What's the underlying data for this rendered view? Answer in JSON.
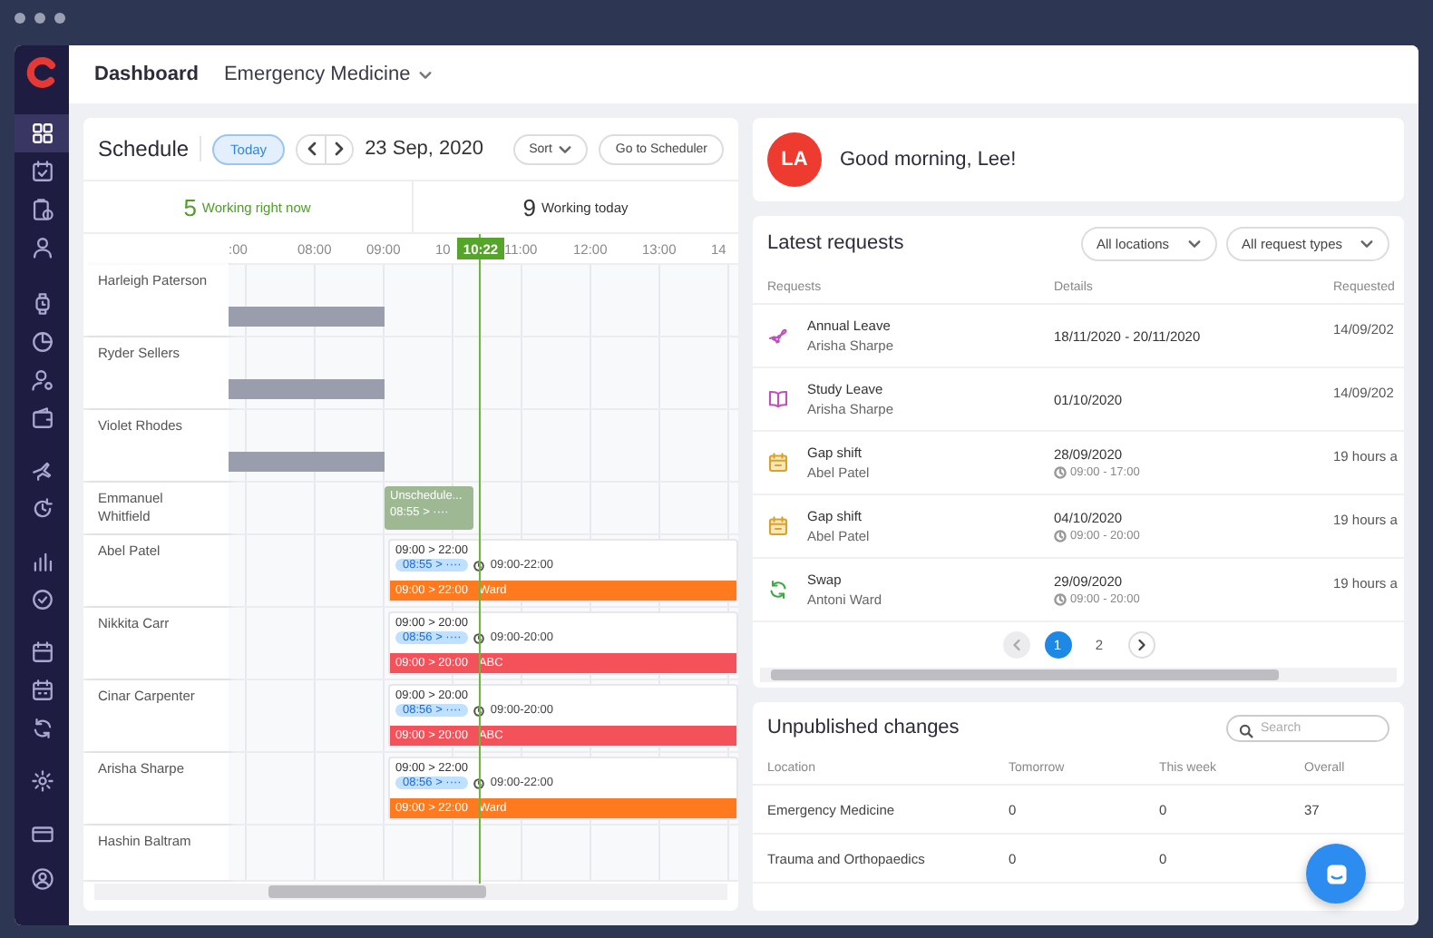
{
  "sidebar": {
    "items": [
      {
        "selected": true
      },
      {
        "selected": false
      },
      {
        "selected": false
      },
      {
        "selected": false
      },
      {
        "selected": false
      },
      {
        "selected": false
      },
      {
        "selected": false
      },
      {
        "selected": false
      },
      {
        "selected": false
      },
      {
        "selected": false
      },
      {
        "selected": false
      },
      {
        "selected": false
      },
      {
        "selected": false
      },
      {
        "selected": false
      },
      {
        "selected": false
      },
      {
        "selected": false
      },
      {
        "selected": false
      },
      {
        "selected": false
      }
    ]
  },
  "header": {
    "title": "Dashboard",
    "location": "Emergency Medicine"
  },
  "schedule": {
    "title": "Schedule",
    "today": "Today",
    "date": "23 Sep, 2020",
    "sort": "Sort",
    "goto": "Go to Scheduler",
    "stats": [
      {
        "kind": "now",
        "count": "5",
        "label": "Working right now"
      },
      {
        "kind": "total",
        "count": "9",
        "label": "Working today"
      }
    ],
    "hours": [
      ":00",
      "08:00",
      "09:00",
      "10",
      "11:00",
      "12:00",
      "13:00",
      "14"
    ],
    "now": "10:22",
    "rows": [
      {
        "kind": "off",
        "name": "Harleigh Paterson"
      },
      {
        "kind": "off",
        "name": "Ryder Sellers"
      },
      {
        "kind": "off",
        "name": "Violet Rhodes"
      },
      {
        "kind": "unscheduled",
        "name": "Emmanuel Whitfield",
        "label": "Unschedule...",
        "clock": "08:55 >  ····"
      },
      {
        "kind": "shift",
        "name": "Abel Patel",
        "planned": "09:00 > 22:00",
        "clock": "08:55 >  ····",
        "window": "09:00-22:00",
        "band": "09:00 > 22:00",
        "area": "Ward",
        "color": "#ff7a1f"
      },
      {
        "kind": "shift",
        "name": "Nikkita Carr",
        "planned": "09:00 > 20:00",
        "clock": "08:56 >  ····",
        "window": "09:00-20:00",
        "band": "09:00 > 20:00",
        "area": "ABC",
        "color": "#f4525a"
      },
      {
        "kind": "shift",
        "name": "Cinar Carpenter",
        "planned": "09:00 > 20:00",
        "clock": "08:56 >  ····",
        "window": "09:00-20:00",
        "band": "09:00 > 20:00",
        "area": "ABC",
        "color": "#f4525a"
      },
      {
        "kind": "shift",
        "name": "Arisha Sharpe",
        "planned": "09:00 > 22:00",
        "clock": "08:56 >  ····",
        "window": "09:00-22:00",
        "band": "09:00 > 22:00",
        "area": "Ward",
        "color": "#ff7a1f"
      },
      {
        "kind": "empty",
        "name": "Hashin Baltram"
      }
    ]
  },
  "greeting": {
    "initials": "LA",
    "text": "Good morning, Lee!"
  },
  "requests": {
    "title": "Latest requests",
    "filters": [
      "All locations",
      "All request types"
    ],
    "columns": [
      "Requests",
      "Details",
      "Requested"
    ],
    "rows": [
      {
        "kind": "annual",
        "type": "Annual Leave",
        "name": "Arisha Sharpe",
        "details": "18/11/2020 - 20/11/2020",
        "requested": "14/09/202"
      },
      {
        "kind": "study",
        "type": "Study Leave",
        "name": "Arisha Sharpe",
        "details": "01/10/2020",
        "requested": "14/09/202"
      },
      {
        "kind": "gap",
        "type": "Gap shift",
        "name": "Abel Patel",
        "details": "28/09/2020",
        "time": "09:00 - 17:00",
        "requested": "19 hours a"
      },
      {
        "kind": "gap",
        "type": "Gap shift",
        "name": "Abel Patel",
        "details": "04/10/2020",
        "time": "09:00 - 20:00",
        "requested": "19 hours a"
      },
      {
        "kind": "swap",
        "type": "Swap",
        "name": "Antoni Ward",
        "details": "29/09/2020",
        "time": "09:00 - 20:00",
        "requested": "19 hours a"
      }
    ],
    "prev": {
      "disabled": true
    },
    "pages": [
      {
        "label": "1",
        "selected": true
      },
      {
        "label": "2",
        "selected": false
      }
    ],
    "next": {
      "disabled": false
    }
  },
  "unpublished": {
    "title": "Unpublished changes",
    "search": {
      "placeholder": "Search"
    },
    "columns": [
      "Location",
      "Tomorrow",
      "This week",
      "Overall"
    ],
    "rows": [
      [
        "Emergency Medicine",
        "0",
        "0",
        "37"
      ],
      [
        "Trauma and Orthopaedics",
        "0",
        "0"
      ]
    ]
  }
}
